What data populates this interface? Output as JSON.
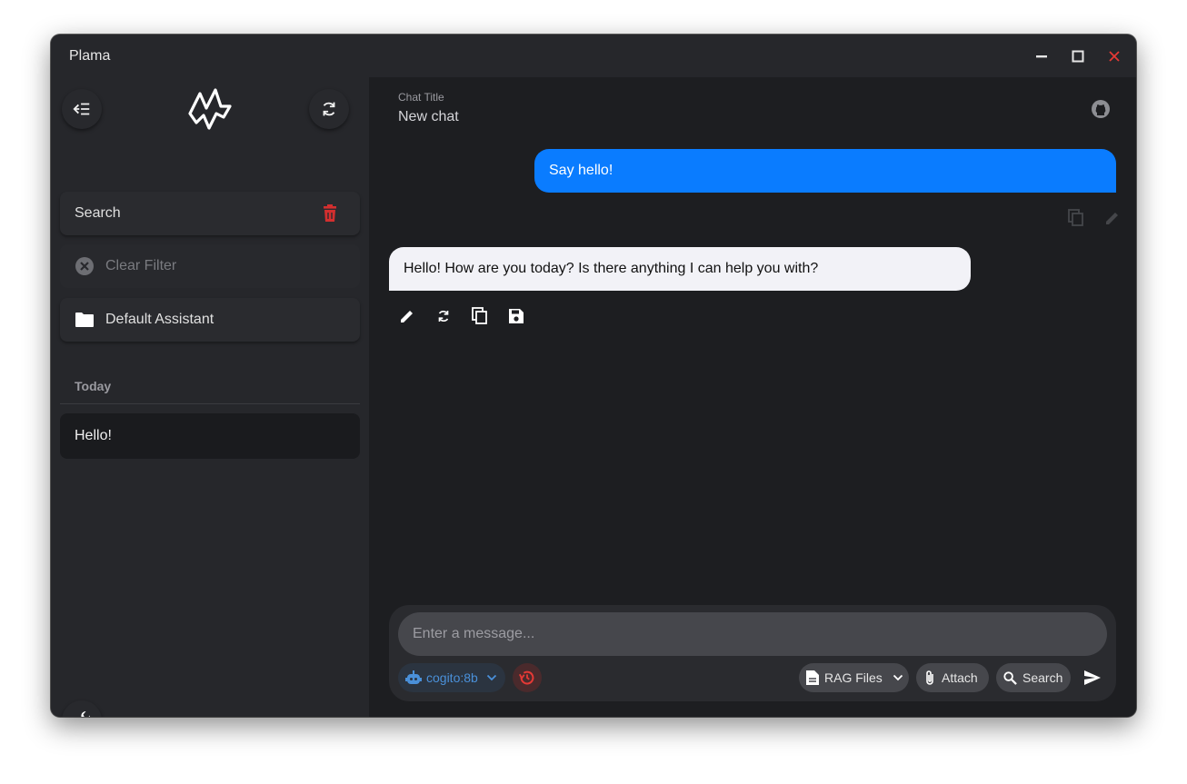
{
  "window": {
    "title": "Plama"
  },
  "sidebar": {
    "search_label": "Search",
    "clear_filter_label": "Clear Filter",
    "assistant_label": "Default Assistant",
    "section_today": "Today",
    "chats": [
      {
        "label": "Hello!"
      }
    ]
  },
  "chat": {
    "title_label": "Chat Title",
    "title_value": "New chat",
    "messages": [
      {
        "role": "user",
        "text": "Say hello!"
      },
      {
        "role": "assistant",
        "text": "Hello! How are you today? Is there anything I can help you with?"
      }
    ]
  },
  "composer": {
    "placeholder": "Enter a message...",
    "model": "cogito:8b",
    "rag_files_label": "RAG Files",
    "attach_label": "Attach",
    "search_label": "Search"
  },
  "colors": {
    "accent": "#0a7cff",
    "danger": "#d32f2f",
    "model_text": "#4a90d9"
  },
  "icons": [
    "menu-collapse-icon",
    "app-logo",
    "refresh-icon",
    "trash-icon",
    "clear-icon",
    "folder-icon",
    "wrench-icon",
    "github-icon",
    "copy-icon",
    "edit-icon",
    "delete-icon",
    "save-icon",
    "robot-icon",
    "chevron-down-icon",
    "reset-icon",
    "document-icon",
    "paperclip-icon",
    "magnify-icon",
    "send-icon",
    "minimize-icon",
    "maximize-icon",
    "close-icon"
  ]
}
